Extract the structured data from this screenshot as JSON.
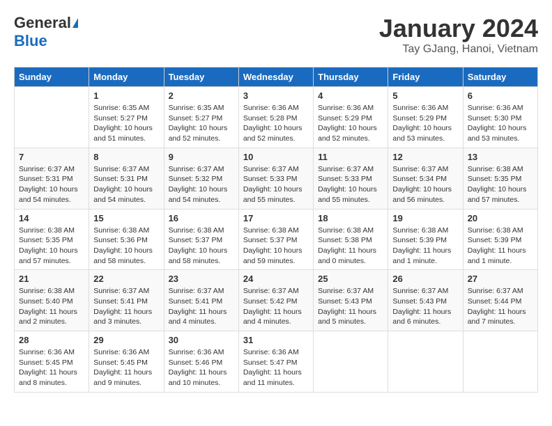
{
  "header": {
    "logo_general": "General",
    "logo_blue": "Blue",
    "title": "January 2024",
    "location": "Tay GJang, Hanoi, Vietnam"
  },
  "days_of_week": [
    "Sunday",
    "Monday",
    "Tuesday",
    "Wednesday",
    "Thursday",
    "Friday",
    "Saturday"
  ],
  "weeks": [
    [
      {
        "day": "",
        "info": ""
      },
      {
        "day": "1",
        "info": "Sunrise: 6:35 AM\nSunset: 5:27 PM\nDaylight: 10 hours\nand 51 minutes."
      },
      {
        "day": "2",
        "info": "Sunrise: 6:35 AM\nSunset: 5:27 PM\nDaylight: 10 hours\nand 52 minutes."
      },
      {
        "day": "3",
        "info": "Sunrise: 6:36 AM\nSunset: 5:28 PM\nDaylight: 10 hours\nand 52 minutes."
      },
      {
        "day": "4",
        "info": "Sunrise: 6:36 AM\nSunset: 5:29 PM\nDaylight: 10 hours\nand 52 minutes."
      },
      {
        "day": "5",
        "info": "Sunrise: 6:36 AM\nSunset: 5:29 PM\nDaylight: 10 hours\nand 53 minutes."
      },
      {
        "day": "6",
        "info": "Sunrise: 6:36 AM\nSunset: 5:30 PM\nDaylight: 10 hours\nand 53 minutes."
      }
    ],
    [
      {
        "day": "7",
        "info": "Sunrise: 6:37 AM\nSunset: 5:31 PM\nDaylight: 10 hours\nand 54 minutes."
      },
      {
        "day": "8",
        "info": "Sunrise: 6:37 AM\nSunset: 5:31 PM\nDaylight: 10 hours\nand 54 minutes."
      },
      {
        "day": "9",
        "info": "Sunrise: 6:37 AM\nSunset: 5:32 PM\nDaylight: 10 hours\nand 54 minutes."
      },
      {
        "day": "10",
        "info": "Sunrise: 6:37 AM\nSunset: 5:33 PM\nDaylight: 10 hours\nand 55 minutes."
      },
      {
        "day": "11",
        "info": "Sunrise: 6:37 AM\nSunset: 5:33 PM\nDaylight: 10 hours\nand 55 minutes."
      },
      {
        "day": "12",
        "info": "Sunrise: 6:37 AM\nSunset: 5:34 PM\nDaylight: 10 hours\nand 56 minutes."
      },
      {
        "day": "13",
        "info": "Sunrise: 6:38 AM\nSunset: 5:35 PM\nDaylight: 10 hours\nand 57 minutes."
      }
    ],
    [
      {
        "day": "14",
        "info": "Sunrise: 6:38 AM\nSunset: 5:35 PM\nDaylight: 10 hours\nand 57 minutes."
      },
      {
        "day": "15",
        "info": "Sunrise: 6:38 AM\nSunset: 5:36 PM\nDaylight: 10 hours\nand 58 minutes."
      },
      {
        "day": "16",
        "info": "Sunrise: 6:38 AM\nSunset: 5:37 PM\nDaylight: 10 hours\nand 58 minutes."
      },
      {
        "day": "17",
        "info": "Sunrise: 6:38 AM\nSunset: 5:37 PM\nDaylight: 10 hours\nand 59 minutes."
      },
      {
        "day": "18",
        "info": "Sunrise: 6:38 AM\nSunset: 5:38 PM\nDaylight: 11 hours\nand 0 minutes."
      },
      {
        "day": "19",
        "info": "Sunrise: 6:38 AM\nSunset: 5:39 PM\nDaylight: 11 hours\nand 1 minute."
      },
      {
        "day": "20",
        "info": "Sunrise: 6:38 AM\nSunset: 5:39 PM\nDaylight: 11 hours\nand 1 minute."
      }
    ],
    [
      {
        "day": "21",
        "info": "Sunrise: 6:38 AM\nSunset: 5:40 PM\nDaylight: 11 hours\nand 2 minutes."
      },
      {
        "day": "22",
        "info": "Sunrise: 6:37 AM\nSunset: 5:41 PM\nDaylight: 11 hours\nand 3 minutes."
      },
      {
        "day": "23",
        "info": "Sunrise: 6:37 AM\nSunset: 5:41 PM\nDaylight: 11 hours\nand 4 minutes."
      },
      {
        "day": "24",
        "info": "Sunrise: 6:37 AM\nSunset: 5:42 PM\nDaylight: 11 hours\nand 4 minutes."
      },
      {
        "day": "25",
        "info": "Sunrise: 6:37 AM\nSunset: 5:43 PM\nDaylight: 11 hours\nand 5 minutes."
      },
      {
        "day": "26",
        "info": "Sunrise: 6:37 AM\nSunset: 5:43 PM\nDaylight: 11 hours\nand 6 minutes."
      },
      {
        "day": "27",
        "info": "Sunrise: 6:37 AM\nSunset: 5:44 PM\nDaylight: 11 hours\nand 7 minutes."
      }
    ],
    [
      {
        "day": "28",
        "info": "Sunrise: 6:36 AM\nSunset: 5:45 PM\nDaylight: 11 hours\nand 8 minutes."
      },
      {
        "day": "29",
        "info": "Sunrise: 6:36 AM\nSunset: 5:45 PM\nDaylight: 11 hours\nand 9 minutes."
      },
      {
        "day": "30",
        "info": "Sunrise: 6:36 AM\nSunset: 5:46 PM\nDaylight: 11 hours\nand 10 minutes."
      },
      {
        "day": "31",
        "info": "Sunrise: 6:36 AM\nSunset: 5:47 PM\nDaylight: 11 hours\nand 11 minutes."
      },
      {
        "day": "",
        "info": ""
      },
      {
        "day": "",
        "info": ""
      },
      {
        "day": "",
        "info": ""
      }
    ]
  ]
}
